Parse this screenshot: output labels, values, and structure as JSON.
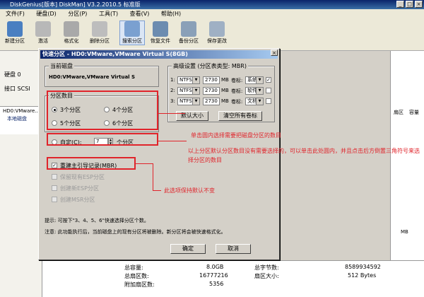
{
  "window": {
    "title": "DiskGenius[版本] DiskMan] V3.2.2010.5 标准版",
    "buttons": [
      "_",
      "□",
      "×"
    ]
  },
  "menu": [
    "文件(F)",
    "硬盘(D)",
    "分区(P)",
    "工具(T)",
    "查看(V)",
    "帮助(H)"
  ],
  "toolbar": {
    "items": [
      "新建分区",
      "激活",
      "格式化",
      "删除分区",
      "搜索分区",
      "恢复文件",
      "备份分区",
      "保存更改"
    ]
  },
  "left_panel": {
    "disk_label": "硬盘 0",
    "port_label": "接口 SCSI",
    "tree": [
      "HD0:VMware...",
      "本地磁盘"
    ]
  },
  "right_panel": {
    "cols": [
      "扇区",
      "容量"
    ],
    "mb": "MB"
  },
  "bottom_status": {
    "rows": [
      {
        "label": "总容量:",
        "value": "8.0GB",
        "label2": "总字节数:",
        "value2": "8589934592"
      },
      {
        "label": "总扇区数:",
        "value": "16777216",
        "label2": "扇区大小:",
        "value2": "512 Bytes"
      },
      {
        "label": "附加扇区数:",
        "value": "5356",
        "label2": "",
        "value2": ""
      }
    ]
  },
  "dialog": {
    "title": "快速分区 - HD0:VMware,VMware Virtual S(8GB)",
    "close": "×",
    "current_disk_legend": "当前磁盘",
    "current_disk_value": "HD0:VMware,VMware Virtual S",
    "partition_count_legend": "分区数目",
    "options": [
      "3个分区",
      "4个分区",
      "5个分区",
      "6个分区"
    ],
    "custom_label": "自定(C):",
    "custom_value": "7",
    "custom_suffix": "个分区",
    "rebuild_mbr": "重建主引导记录(MBR)",
    "disabled_options": [
      "保留现有ESP分区",
      "创建新ESP分区",
      "创建MSR分区"
    ],
    "advanced_legend": "高级设置 (分区表类型: MBR)",
    "rows": [
      {
        "num": "1:",
        "fs": "NTFS",
        "size": "2730",
        "unit": "MB",
        "vol_label": "卷标:",
        "vol": "系统",
        "primary": "主分区"
      },
      {
        "num": "2:",
        "fs": "NTFS",
        "size": "2730",
        "unit": "MB",
        "vol_label": "卷标:",
        "vol": "软件",
        "primary": "主分区"
      },
      {
        "num": "3:",
        "fs": "NTFS",
        "size": "2730",
        "unit": "MB",
        "vol_label": "卷标:",
        "vol": "文档",
        "primary": "主分区"
      }
    ],
    "default_size_btn": "默认大小",
    "clear_labels_btn": "清空所有卷标",
    "hint": "提示: 可按下\"3、4、5、6\"快速选择分区个数。",
    "warning": "注意: 此功能执行后，当前磁盘上的现有分区将被删除。新分区将会被快速格式化。",
    "ok": "确定",
    "cancel": "取消"
  },
  "annotations": {
    "a1": "单击圆内选择需要把磁盘分区的数目",
    "a2": "以上分区默认分区数目没有需要选择的，可以单击此处圆内，并且点击后方倒置三角符号来选择分区的数目",
    "a3": "此选项保持默认不变"
  },
  "colors": {
    "accent": "#0a246a",
    "annotation": "#e0242b",
    "dialog_bg": "#d4d0c8"
  }
}
